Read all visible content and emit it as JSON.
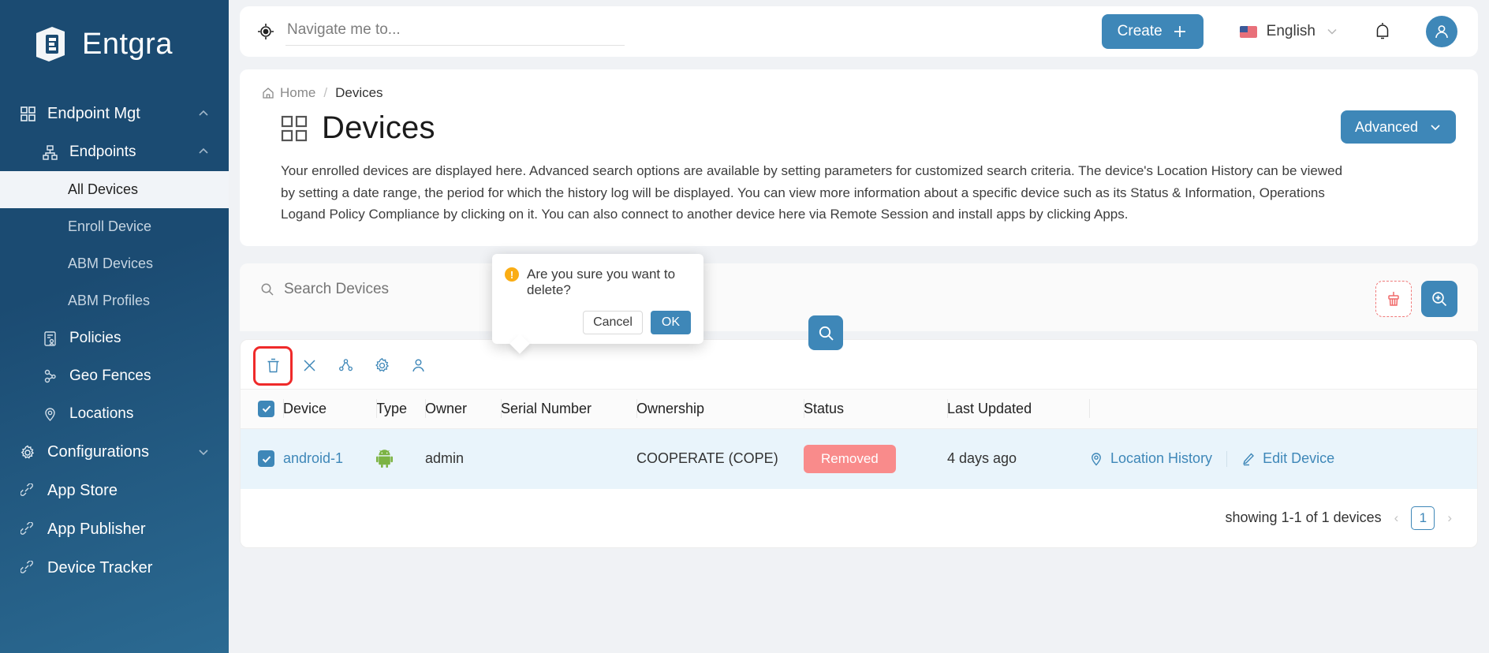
{
  "brand": {
    "name": "Entgra",
    "logo_icon": "entgra-logo-icon"
  },
  "sidebar": {
    "items": [
      {
        "label": "Endpoint Mgt",
        "icon": "grid-icon",
        "level": 1,
        "expanded": true,
        "chevron": "chevron-up-icon"
      },
      {
        "label": "Endpoints",
        "icon": "sitemap-icon",
        "level": 2,
        "expanded": true,
        "chevron": "chevron-up-icon"
      },
      {
        "label": "All Devices",
        "icon": "",
        "level": 3,
        "active": true
      },
      {
        "label": "Enroll Device",
        "icon": "",
        "level": 3,
        "active": false
      },
      {
        "label": "ABM Devices",
        "icon": "",
        "level": 3,
        "active": false
      },
      {
        "label": "ABM Profiles",
        "icon": "",
        "level": 3,
        "active": false
      },
      {
        "label": "Policies",
        "icon": "policy-icon",
        "level": 2,
        "active": false
      },
      {
        "label": "Geo Fences",
        "icon": "geofence-icon",
        "level": 2,
        "active": false
      },
      {
        "label": "Locations",
        "icon": "location-pin-icon",
        "level": 2,
        "active": false
      },
      {
        "label": "Configurations",
        "icon": "gear-icon",
        "level": 1,
        "expanded": false,
        "chevron": "chevron-down-icon"
      },
      {
        "label": "App Store",
        "icon": "link-icon",
        "level": 1,
        "active": false
      },
      {
        "label": "App Publisher",
        "icon": "link-icon",
        "level": 1,
        "active": false
      },
      {
        "label": "Device Tracker",
        "icon": "link-icon",
        "level": 1,
        "active": false
      }
    ]
  },
  "header": {
    "nav_search_placeholder": "Navigate me to...",
    "nav_search_value": "",
    "nav_icon": "crosshair-icon",
    "create_label": "Create",
    "create_icon": "plus-icon",
    "language": "English",
    "language_chevron": "chevron-down-icon",
    "flag_icon": "us-flag-icon",
    "notification_icon": "bell-icon",
    "avatar_icon": "user-avatar-icon"
  },
  "breadcrumb": {
    "home": "Home",
    "separator": "/",
    "current": "Devices",
    "home_icon": "home-icon"
  },
  "page": {
    "title": "Devices",
    "title_icon": "grid-icon",
    "advanced_label": "Advanced",
    "advanced_chevron": "chevron-down-icon",
    "description": "Your enrolled devices are displayed here. Advanced search options are available by setting parameters for customized search criteria. The device's Location History can be viewed by setting a date range, the period for which the history log will be displayed. You can view more information about a specific device such as its Status & Information, Operations Logand Policy Compliance by clicking on it. You can also connect to another device here via Remote Session and install apps by clicking Apps."
  },
  "search": {
    "placeholder": "Search Devices",
    "value": "",
    "search_icon": "search-icon",
    "submit_icon": "search-icon",
    "clear_icon": "clear-broom-icon",
    "zoom_icon": "zoom-in-icon"
  },
  "popover": {
    "message": "Are you sure you want to delete?",
    "warning_icon": "warning-icon",
    "cancel_label": "Cancel",
    "ok_label": "OK"
  },
  "toolbar": {
    "icons": [
      {
        "name": "delete-icon",
        "selected": true
      },
      {
        "name": "close-x-icon",
        "selected": false
      },
      {
        "name": "share-group-icon",
        "selected": false
      },
      {
        "name": "gear-icon",
        "selected": false
      },
      {
        "name": "assign-user-icon",
        "selected": false
      }
    ]
  },
  "table": {
    "select_all_checked": true,
    "columns": [
      "Device",
      "Type",
      "Owner",
      "Serial Number",
      "Ownership",
      "Status",
      "Last Updated",
      ""
    ],
    "rows": [
      {
        "checked": true,
        "device": "android-1",
        "type_icon": "android-icon",
        "owner": "admin",
        "serial": "",
        "ownership": "COOPERATE (COPE)",
        "status": "Removed",
        "status_color": "#f98b8b",
        "last_updated": "4 days ago",
        "actions": [
          {
            "label": "Location History",
            "icon": "location-pin-icon"
          },
          {
            "label": "Edit Device",
            "icon": "pencil-icon"
          }
        ]
      }
    ]
  },
  "pagination": {
    "summary": "showing 1-1 of 1 devices",
    "prev_icon": "chevron-left-icon",
    "next_icon": "chevron-right-icon",
    "current_page": "1"
  },
  "colors": {
    "primary": "#3e87b8",
    "sidebar": "#1b4b72",
    "danger": "#f98b8b",
    "warning": "#faad14",
    "highlight": "#ef2a2a"
  }
}
